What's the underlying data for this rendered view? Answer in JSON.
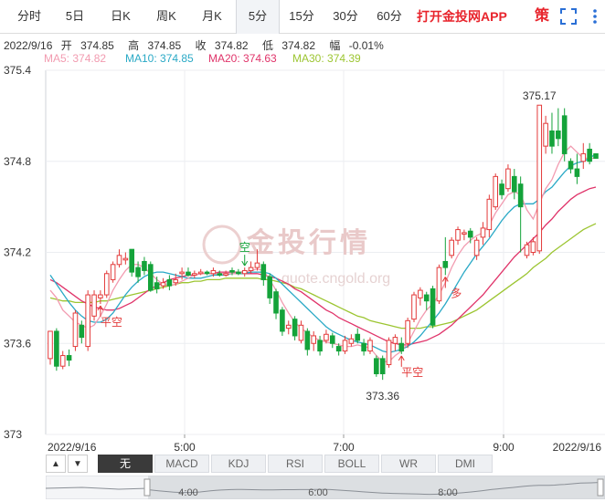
{
  "tabs": {
    "items": [
      "分时",
      "5日",
      "日K",
      "周K",
      "月K",
      "5分",
      "15分",
      "30分",
      "60分"
    ],
    "active": "5分",
    "app_link": "打开金投网APP",
    "ext_icon_glyph": "策"
  },
  "info": {
    "date": "2022/9/16",
    "open_label": "开",
    "open": "374.85",
    "high_label": "高",
    "high": "374.85",
    "close_label": "收",
    "close": "374.82",
    "low_label": "低",
    "low": "374.82",
    "change_label": "幅",
    "change": "-0.01%"
  },
  "ma": [
    {
      "label": "MA5:",
      "value": "374.82",
      "color": "#f29bb0"
    },
    {
      "label": "MA10:",
      "value": "374.85",
      "color": "#2aa9c6"
    },
    {
      "label": "MA20:",
      "value": "374.63",
      "color": "#e0346a"
    },
    {
      "label": "MA30:",
      "value": "374.39",
      "color": "#9cc531"
    }
  ],
  "watermark": {
    "text": "金投行情",
    "url": "quote.cngold.org"
  },
  "chart_data": {
    "type": "candlestick",
    "ylim": [
      373,
      375.4
    ],
    "y_ticks": [
      "375.4",
      "374.8",
      "374.2",
      "373.6",
      "373"
    ],
    "x_ticks": [
      "2022/9/16",
      "5:00",
      "7:00",
      "9:00",
      "2022/9/16"
    ],
    "up_color": "#e33a3a",
    "down_color": "#14a33a",
    "candles": [
      [
        373.5,
        373.68,
        373.46,
        373.66
      ],
      [
        373.68,
        373.45,
        373.42,
        373.7
      ],
      [
        373.45,
        373.52,
        373.43,
        373.55
      ],
      [
        373.52,
        373.49,
        373.45,
        373.56
      ],
      [
        373.58,
        373.8,
        373.55,
        373.82
      ],
      [
        373.72,
        373.64,
        373.6,
        373.75
      ],
      [
        373.58,
        373.92,
        373.55,
        373.95
      ],
      [
        373.78,
        373.92,
        373.75,
        373.95
      ],
      [
        373.9,
        373.92,
        373.86,
        373.95
      ],
      [
        373.92,
        374.06,
        373.9,
        374.08
      ],
      [
        374.02,
        374.12,
        374.0,
        374.14
      ],
      [
        374.12,
        374.18,
        374.1,
        374.22
      ],
      [
        374.15,
        374.16,
        374.12,
        374.2
      ],
      [
        374.22,
        374.07,
        374.04,
        374.22
      ],
      [
        374.1,
        374.04,
        374.0,
        374.14
      ],
      [
        374.14,
        374.08,
        374.05,
        374.17
      ],
      [
        374.12,
        373.95,
        373.94,
        374.14
      ],
      [
        374.0,
        373.96,
        373.93,
        374.04
      ],
      [
        373.98,
        374.0,
        373.96,
        374.03
      ],
      [
        374.02,
        373.98,
        373.95,
        374.05
      ],
      [
        374.0,
        374.02,
        373.98,
        374.06
      ],
      [
        374.06,
        374.07,
        374.02,
        374.1
      ],
      [
        374.07,
        374.05,
        374.04,
        374.1
      ],
      [
        374.05,
        374.06,
        374.03,
        374.08
      ],
      [
        374.06,
        374.07,
        374.05,
        374.09
      ],
      [
        374.07,
        374.06,
        374.05,
        374.08
      ],
      [
        374.06,
        374.08,
        374.04,
        374.1
      ],
      [
        374.06,
        374.05,
        374.04,
        374.08
      ],
      [
        374.05,
        374.06,
        374.04,
        374.08
      ],
      [
        374.08,
        374.07,
        374.05,
        374.1
      ],
      [
        374.07,
        374.06,
        374.05,
        374.09
      ],
      [
        374.06,
        374.08,
        374.04,
        374.1
      ],
      [
        374.08,
        374.1,
        374.06,
        374.14
      ],
      [
        374.1,
        374.13,
        374.08,
        374.22
      ],
      [
        374.12,
        374.02,
        373.98,
        374.14
      ],
      [
        374.04,
        373.9,
        373.86,
        374.06
      ],
      [
        373.94,
        373.8,
        373.76,
        373.96
      ],
      [
        373.82,
        373.68,
        373.65,
        373.84
      ],
      [
        373.7,
        373.72,
        373.66,
        373.75
      ],
      [
        373.76,
        373.65,
        373.62,
        373.78
      ],
      [
        373.62,
        373.72,
        373.6,
        373.75
      ],
      [
        373.68,
        373.56,
        373.52,
        373.7
      ],
      [
        373.6,
        373.65,
        373.55,
        373.68
      ],
      [
        373.62,
        373.55,
        373.52,
        373.65
      ],
      [
        373.62,
        373.66,
        373.6,
        373.69
      ],
      [
        373.65,
        373.6,
        373.57,
        373.67
      ],
      [
        373.58,
        373.55,
        373.52,
        373.6
      ],
      [
        373.55,
        373.62,
        373.53,
        373.65
      ],
      [
        373.6,
        373.63,
        373.58,
        373.66
      ],
      [
        373.66,
        373.62,
        373.6,
        373.7
      ],
      [
        373.6,
        373.55,
        373.52,
        373.63
      ],
      [
        373.55,
        373.62,
        373.53,
        373.64
      ],
      [
        373.5,
        373.4,
        373.38,
        373.52
      ],
      [
        373.5,
        373.4,
        373.36,
        373.52
      ],
      [
        373.46,
        373.62,
        373.44,
        373.64
      ],
      [
        373.6,
        373.64,
        373.55,
        373.66
      ],
      [
        373.6,
        373.55,
        373.53,
        373.64
      ],
      [
        373.6,
        373.75,
        373.57,
        373.77
      ],
      [
        373.76,
        373.92,
        373.74,
        373.94
      ],
      [
        373.9,
        373.95,
        373.85,
        373.97
      ],
      [
        373.92,
        373.88,
        373.82,
        373.94
      ],
      [
        373.96,
        373.72,
        373.7,
        373.98
      ],
      [
        373.88,
        374.1,
        373.86,
        374.12
      ],
      [
        374.14,
        374.1,
        374.05,
        374.3
      ],
      [
        374.18,
        374.28,
        374.16,
        374.3
      ],
      [
        374.28,
        374.35,
        374.25,
        374.37
      ],
      [
        374.32,
        374.33,
        374.28,
        374.35
      ],
      [
        374.34,
        374.3,
        374.26,
        374.36
      ],
      [
        374.18,
        374.28,
        374.15,
        374.3
      ],
      [
        374.3,
        374.36,
        374.25,
        374.4
      ],
      [
        374.35,
        374.55,
        374.3,
        374.58
      ],
      [
        374.5,
        374.7,
        374.48,
        374.72
      ],
      [
        374.65,
        374.58,
        374.55,
        374.68
      ],
      [
        374.62,
        374.75,
        374.6,
        374.78
      ],
      [
        374.7,
        374.6,
        374.55,
        374.75
      ],
      [
        374.65,
        374.5,
        374.2,
        374.7
      ],
      [
        374.18,
        374.25,
        374.16,
        374.27
      ],
      [
        374.2,
        374.27,
        374.18,
        374.3
      ],
      [
        374.21,
        375.17,
        374.19,
        375.17
      ],
      [
        374.9,
        375.05,
        374.85,
        375.1
      ],
      [
        375.0,
        374.9,
        374.85,
        375.12
      ],
      [
        375.0,
        374.95,
        374.9,
        375.15
      ],
      [
        375.1,
        374.85,
        374.8,
        375.15
      ],
      [
        374.8,
        374.75,
        374.72,
        374.82
      ],
      [
        374.75,
        374.7,
        374.65,
        374.85
      ],
      [
        374.8,
        374.85,
        374.75,
        374.92
      ],
      [
        374.88,
        374.8,
        374.78,
        374.92
      ],
      [
        374.85,
        374.82,
        374.82,
        374.85
      ]
    ],
    "ma5": [
      373.95,
      373.9,
      373.82,
      373.78,
      373.74,
      373.72,
      373.7,
      373.72,
      373.78,
      373.86,
      373.95,
      374.02,
      374.08,
      374.12,
      374.12,
      374.1,
      374.06,
      374.02,
      373.99,
      373.98,
      373.99,
      374.01,
      374.03,
      374.05,
      374.06,
      374.06,
      374.06,
      374.06,
      374.06,
      374.06,
      374.06,
      374.07,
      374.08,
      374.09,
      374.08,
      374.02,
      373.95,
      373.87,
      373.8,
      373.74,
      373.7,
      373.67,
      373.64,
      373.62,
      373.61,
      373.6,
      373.59,
      373.58,
      373.58,
      373.59,
      373.58,
      373.57,
      373.52,
      373.48,
      373.48,
      373.52,
      373.55,
      373.6,
      373.68,
      373.76,
      373.82,
      373.86,
      373.92,
      374.0,
      374.1,
      374.18,
      374.24,
      374.28,
      374.31,
      374.33,
      374.38,
      374.46,
      374.52,
      374.58,
      374.6,
      374.58,
      374.48,
      374.42,
      374.52,
      374.62,
      374.68,
      374.78,
      374.86,
      374.9,
      374.86,
      374.82,
      374.82,
      374.82
    ],
    "ma10": [
      374.05,
      373.99,
      373.93,
      373.87,
      373.82,
      373.78,
      373.75,
      373.74,
      373.74,
      373.76,
      373.8,
      373.86,
      373.92,
      373.97,
      374.01,
      374.04,
      374.06,
      374.07,
      374.07,
      374.06,
      374.05,
      374.04,
      374.03,
      374.03,
      374.03,
      374.04,
      374.05,
      374.05,
      374.05,
      374.06,
      374.06,
      374.06,
      374.07,
      374.07,
      374.07,
      374.06,
      374.03,
      373.99,
      373.95,
      373.91,
      373.87,
      373.83,
      373.79,
      373.75,
      373.71,
      373.68,
      373.66,
      373.64,
      373.62,
      373.61,
      373.6,
      373.59,
      373.57,
      373.55,
      373.54,
      373.55,
      373.56,
      373.58,
      373.61,
      373.65,
      373.7,
      373.75,
      373.8,
      373.86,
      373.93,
      374.0,
      374.07,
      374.13,
      374.19,
      374.24,
      374.29,
      374.35,
      374.41,
      374.46,
      374.5,
      374.52,
      374.52,
      374.52,
      374.55,
      374.6,
      374.63,
      374.68,
      374.73,
      374.77,
      374.79,
      374.8,
      374.82,
      374.85
    ],
    "ma20": [
      374.02,
      374.0,
      373.97,
      373.94,
      373.91,
      373.88,
      373.86,
      373.84,
      373.83,
      373.82,
      373.82,
      373.83,
      373.85,
      373.87,
      373.9,
      373.93,
      373.96,
      373.98,
      374.0,
      374.02,
      374.03,
      374.04,
      374.05,
      374.05,
      374.06,
      374.06,
      374.06,
      374.07,
      374.07,
      374.07,
      374.07,
      374.06,
      374.06,
      374.06,
      374.05,
      374.04,
      374.03,
      374.01,
      373.99,
      373.96,
      373.94,
      373.91,
      373.88,
      373.85,
      373.82,
      373.8,
      373.77,
      373.75,
      373.73,
      373.71,
      373.69,
      373.67,
      373.65,
      373.63,
      373.61,
      373.6,
      373.59,
      373.59,
      373.6,
      373.61,
      373.62,
      373.64,
      373.66,
      373.69,
      373.72,
      373.76,
      373.8,
      373.84,
      373.88,
      373.92,
      373.97,
      374.02,
      374.07,
      374.12,
      374.17,
      374.21,
      374.25,
      374.29,
      374.33,
      374.38,
      374.42,
      374.47,
      374.51,
      374.55,
      374.58,
      374.6,
      374.62,
      374.63
    ],
    "ma30": [
      373.9,
      373.89,
      373.88,
      373.88,
      373.87,
      373.87,
      373.87,
      373.87,
      373.88,
      373.88,
      373.89,
      373.9,
      373.91,
      373.92,
      373.93,
      373.94,
      373.95,
      373.96,
      373.97,
      373.98,
      373.99,
      374.0,
      374.0,
      374.01,
      374.01,
      374.02,
      374.02,
      374.02,
      374.03,
      374.03,
      374.03,
      374.03,
      374.03,
      374.03,
      374.02,
      374.02,
      374.01,
      374.0,
      373.99,
      373.97,
      373.96,
      373.94,
      373.92,
      373.9,
      373.88,
      373.86,
      373.84,
      373.82,
      373.8,
      373.78,
      373.77,
      373.75,
      373.74,
      373.73,
      373.72,
      373.71,
      373.7,
      373.7,
      373.7,
      373.7,
      373.71,
      373.71,
      373.72,
      373.73,
      373.74,
      373.76,
      373.78,
      373.8,
      373.82,
      373.85,
      373.88,
      373.91,
      373.94,
      373.97,
      374.0,
      374.03,
      374.06,
      374.1,
      374.13,
      374.16,
      374.2,
      374.23,
      374.26,
      374.29,
      374.32,
      374.35,
      374.37,
      374.39
    ],
    "annotations": [
      {
        "text": "375.17",
        "candle": 78,
        "pos": "above"
      },
      {
        "text": "373.36",
        "candle": 53,
        "pos": "below"
      }
    ],
    "markers": [
      {
        "text": "平空",
        "candle": 8,
        "color": "#e33a3a",
        "dir": "up"
      },
      {
        "text": "空",
        "candle": 31,
        "color": "#14a33a",
        "dir": "down"
      },
      {
        "text": "平空",
        "candle": 56,
        "color": "#e33a3a",
        "dir": "up"
      },
      {
        "text": "多",
        "candle": 63,
        "color": "#e33a3a",
        "dir": "up"
      }
    ]
  },
  "toolbar": {
    "left_arrow": "▲",
    "right_arrow": "▼",
    "indicators": [
      "无",
      "MACD",
      "KDJ",
      "RSI",
      "BOLL",
      "WR",
      "DMI"
    ],
    "active_indicator": "无"
  },
  "navigator": {
    "labels": [
      "4:00",
      "6:00",
      "8:00"
    ]
  }
}
